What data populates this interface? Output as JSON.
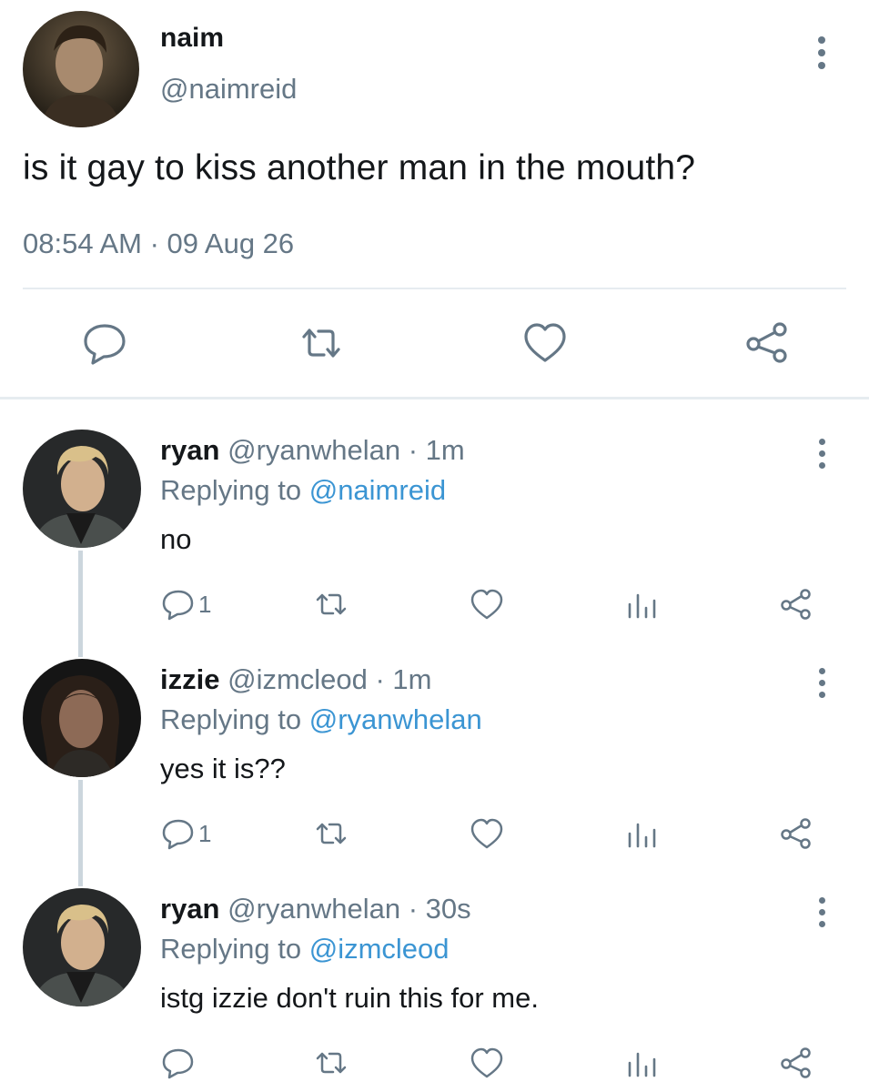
{
  "main_tweet": {
    "display_name": "naim",
    "handle": "@naimreid",
    "text": "is it gay to kiss another man in the mouth?",
    "timestamp": "08:54 AM · 09 Aug 26",
    "actions": [
      "reply-icon",
      "retweet-icon",
      "like-icon",
      "share-icon"
    ]
  },
  "replies": [
    {
      "display_name": "ryan",
      "handle_time": "@ryanwhelan · 1m",
      "replying_prefix": "Replying to ",
      "replying_to": "@naimreid",
      "text": "no",
      "reply_count": "1"
    },
    {
      "display_name": "izzie",
      "handle_time": "@izmcleod · 1m",
      "replying_prefix": "Replying to ",
      "replying_to": "@ryanwhelan",
      "text": "yes it is??",
      "reply_count": "1"
    },
    {
      "display_name": "ryan",
      "handle_time": "@ryanwhelan · 30s",
      "replying_prefix": "Replying to ",
      "replying_to": "@izmcleod",
      "text": "istg izzie don't ruin this for me.",
      "reply_count": ""
    }
  ],
  "colors": {
    "text": "#14171a",
    "secondary": "#657786",
    "link": "#3b95d3",
    "divider": "#e6ecf0"
  }
}
